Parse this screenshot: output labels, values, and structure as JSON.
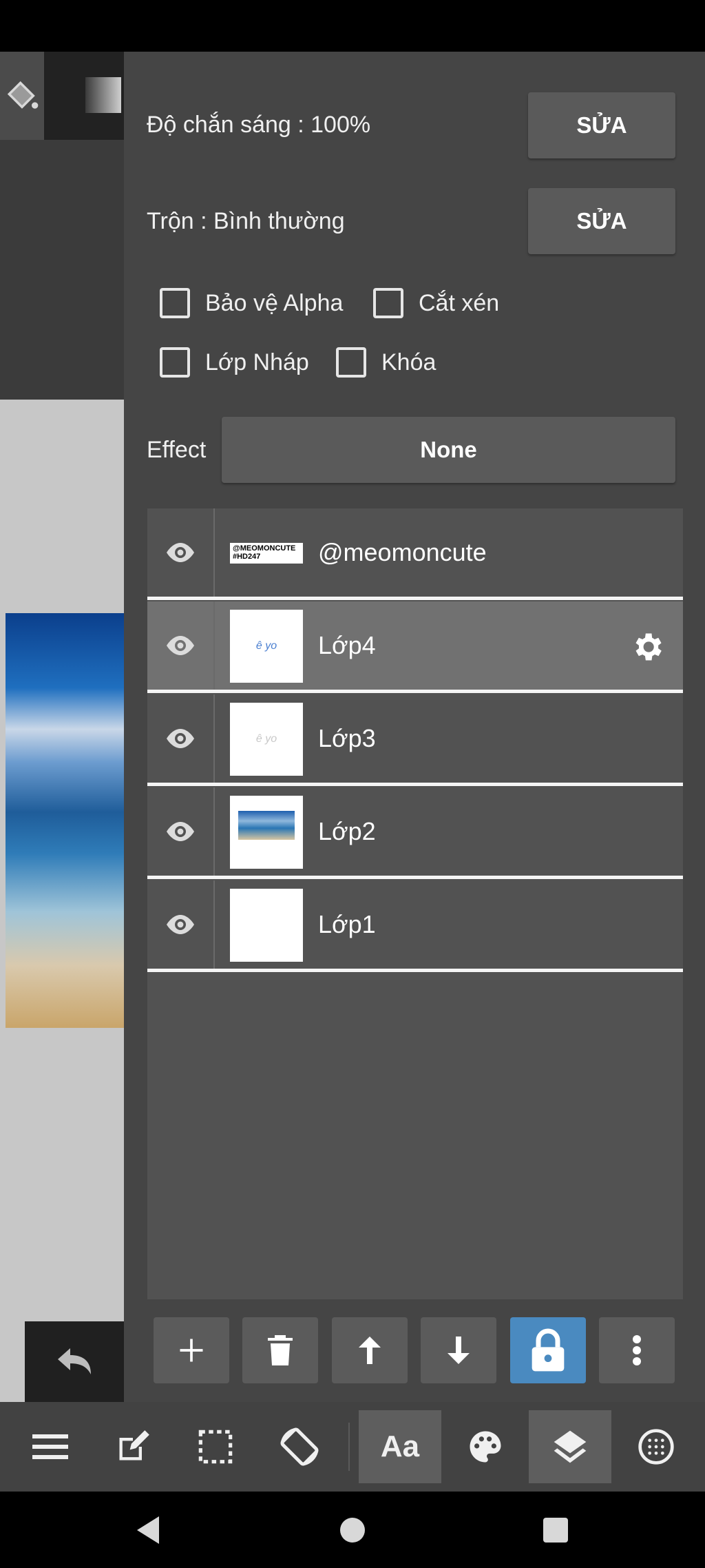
{
  "properties": {
    "opacity_label": "Độ chắn sáng : 100%",
    "opacity_edit": "SỬA",
    "blend_label": "Trộn : Bình thường",
    "blend_edit": "SỬA"
  },
  "checkboxes": {
    "alpha_protect": "Bảo vệ Alpha",
    "clipping": "Cắt xén",
    "draft_layer": "Lớp Nháp",
    "lock": "Khóa"
  },
  "effect": {
    "label": "Effect",
    "value": "None"
  },
  "layers": [
    {
      "name": "@meomoncute",
      "thumb_text_1": "@MEOMONCUTE",
      "thumb_text_2": "#HD247"
    },
    {
      "name": "Lớp4",
      "thumb_text": "ê yo"
    },
    {
      "name": "Lớp3",
      "thumb_text": "ê yo"
    },
    {
      "name": "Lớp2"
    },
    {
      "name": "Lớp1"
    }
  ],
  "layer_tools": {
    "add_icon": "plus-icon",
    "delete_icon": "trash-icon",
    "move_up_icon": "arrow-up-icon",
    "move_down_icon": "arrow-down-icon",
    "lock_icon": "lock-icon",
    "more_icon": "more-vertical-icon"
  },
  "toolbar": {
    "text_tool_label": "Aa"
  },
  "colors": {
    "panel_bg": "#454545",
    "list_bg": "#525252",
    "selected_row": "#717171",
    "lock_active": "#4a8ac0"
  }
}
